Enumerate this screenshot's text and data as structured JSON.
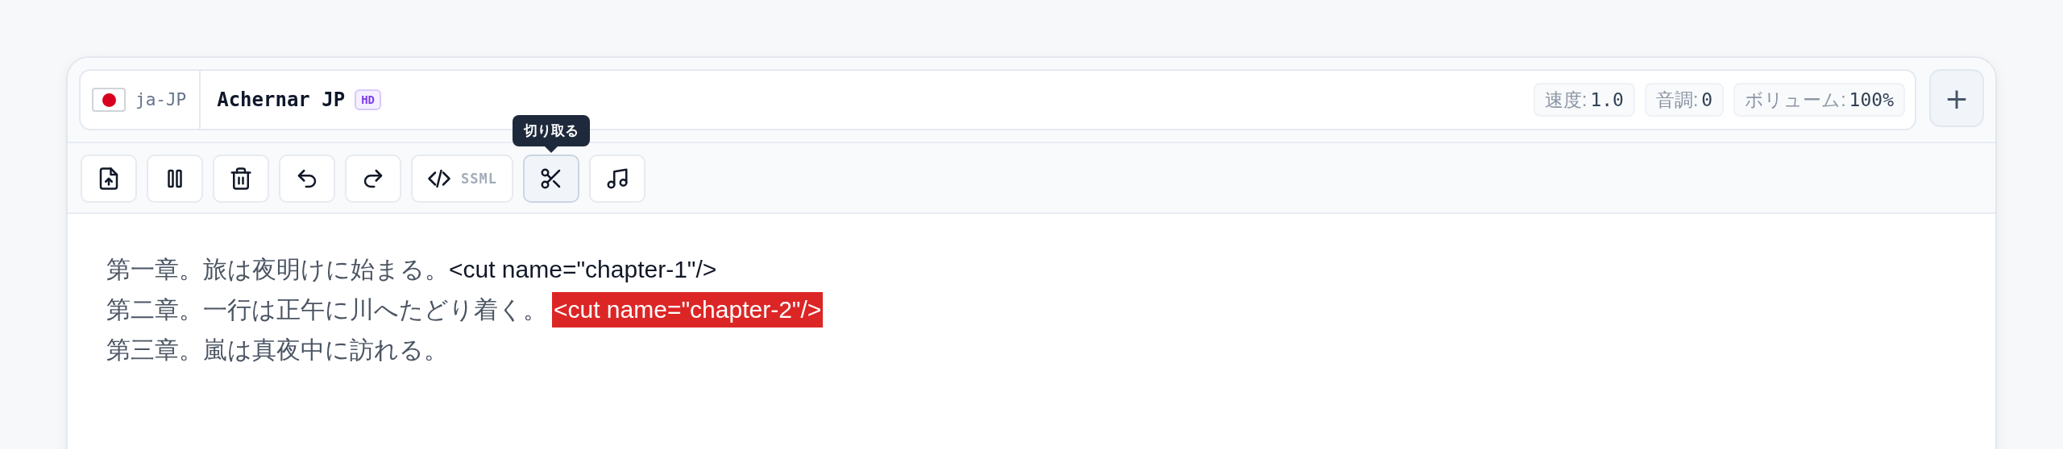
{
  "voice": {
    "locale": "ja-JP",
    "name": "Achernar JP",
    "badge": "HD"
  },
  "settings": [
    {
      "label": "速度:",
      "value": "1.0"
    },
    {
      "label": "音調:",
      "value": "0"
    },
    {
      "label": "ボリューム:",
      "value": "100%"
    }
  ],
  "add_button": "+",
  "toolbar": [
    {
      "kind": "upload",
      "selected": false
    },
    {
      "kind": "pause",
      "selected": false
    },
    {
      "kind": "trash",
      "selected": false
    },
    {
      "kind": "undo",
      "selected": false
    },
    {
      "kind": "redo",
      "selected": false
    },
    {
      "kind": "code",
      "label": "SSML",
      "selected": false
    },
    {
      "kind": "scissors",
      "selected": true,
      "tooltip": "切り取る"
    },
    {
      "kind": "music",
      "selected": false
    }
  ],
  "editor": {
    "lines": [
      {
        "segments": [
          {
            "kind": "text",
            "text": "第一章。旅は夜明けに始まる。"
          },
          {
            "kind": "tag",
            "text": "<cut name=\"chapter-1\"/>",
            "highlighted": false
          }
        ]
      },
      {
        "segments": [
          {
            "kind": "text",
            "text": "第二章。一行は正午に川へたどり着く。"
          },
          {
            "kind": "tag",
            "text": "<cut name=\"chapter-2\"/>",
            "highlighted": true
          }
        ]
      },
      {
        "segments": [
          {
            "kind": "text",
            "text": "第三章。嵐は真夜中に訪れる。"
          }
        ]
      }
    ]
  }
}
